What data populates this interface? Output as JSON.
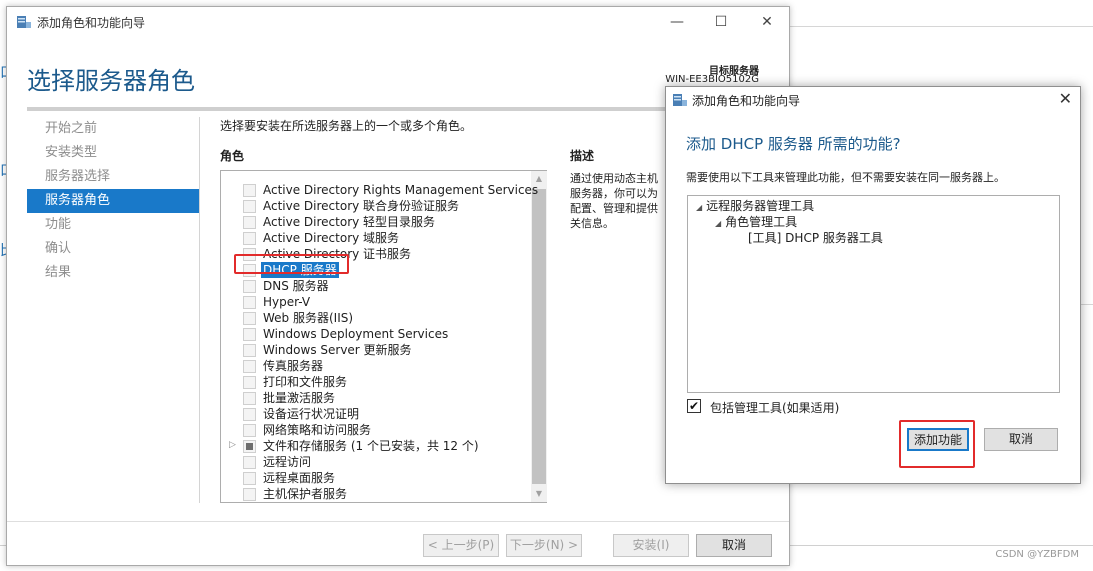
{
  "background": {
    "letters": [
      "口",
      "口",
      "比"
    ],
    "watermark": "CSDN @YZBFDM"
  },
  "wizard": {
    "window_title": "添加角色和功能向导",
    "controls": {
      "minimize": "—",
      "maximize": "☐",
      "close": "✕"
    },
    "page_title": "选择服务器角色",
    "target_label": "目标服务器",
    "target_value": "WIN-EE3BIO5102G",
    "nav": [
      {
        "label": "开始之前",
        "active": false
      },
      {
        "label": "安装类型",
        "active": false
      },
      {
        "label": "服务器选择",
        "active": false
      },
      {
        "label": "服务器角色",
        "active": true
      },
      {
        "label": "功能",
        "active": false
      },
      {
        "label": "确认",
        "active": false
      },
      {
        "label": "结果",
        "active": false
      }
    ],
    "instruction": "选择要安装在所选服务器上的一个或多个角色。",
    "roles_header": "角色",
    "description_header": "描述",
    "description_lines": [
      "通过使用动态主机",
      "服务器，你可以为",
      "配置、管理和提供",
      "关信息。"
    ],
    "roles": [
      {
        "label": "Active Directory Rights Management Services",
        "state": "unchecked"
      },
      {
        "label": "Active Directory 联合身份验证服务",
        "state": "unchecked"
      },
      {
        "label": "Active Directory 轻型目录服务",
        "state": "unchecked"
      },
      {
        "label": "Active Directory 域服务",
        "state": "unchecked"
      },
      {
        "label": "Active Directory 证书服务",
        "state": "unchecked"
      },
      {
        "label": "DHCP 服务器",
        "state": "unchecked",
        "selected": true
      },
      {
        "label": "DNS 服务器",
        "state": "unchecked"
      },
      {
        "label": "Hyper-V",
        "state": "unchecked"
      },
      {
        "label": "Web 服务器(IIS)",
        "state": "unchecked"
      },
      {
        "label": "Windows Deployment Services",
        "state": "unchecked"
      },
      {
        "label": "Windows Server 更新服务",
        "state": "unchecked"
      },
      {
        "label": "传真服务器",
        "state": "unchecked"
      },
      {
        "label": "打印和文件服务",
        "state": "unchecked"
      },
      {
        "label": "批量激活服务",
        "state": "unchecked"
      },
      {
        "label": "设备运行状况证明",
        "state": "unchecked"
      },
      {
        "label": "网络策略和访问服务",
        "state": "unchecked"
      },
      {
        "label": "文件和存储服务 (1 个已安装，共 12 个)",
        "state": "partial",
        "expandable": true
      },
      {
        "label": "远程访问",
        "state": "unchecked"
      },
      {
        "label": "远程桌面服务",
        "state": "unchecked"
      },
      {
        "label": "主机保护者服务",
        "state": "unchecked"
      }
    ],
    "buttons": {
      "previous": "< 上一步(P)",
      "next": "下一步(N) >",
      "install": "安装(I)",
      "cancel": "取消"
    }
  },
  "dialog": {
    "title": "添加角色和功能向导",
    "close": "✕",
    "heading": "添加 DHCP 服务器 所需的功能?",
    "subtext": "需要使用以下工具来管理此功能，但不需要安装在同一服务器上。",
    "tree": [
      {
        "label": "远程服务器管理工具",
        "level": 0
      },
      {
        "label": "角色管理工具",
        "level": 1
      },
      {
        "label": "[工具] DHCP 服务器工具",
        "level": 2
      }
    ],
    "include_tools_label": "包括管理工具(如果适用)",
    "include_tools_checked": true,
    "check_mark": "✔",
    "buttons": {
      "add_features": "添加功能",
      "cancel": "取消"
    }
  },
  "colors": {
    "accent": "#1979c9",
    "title_blue": "#1c5a8c",
    "highlight_red": "#e22b2b"
  }
}
